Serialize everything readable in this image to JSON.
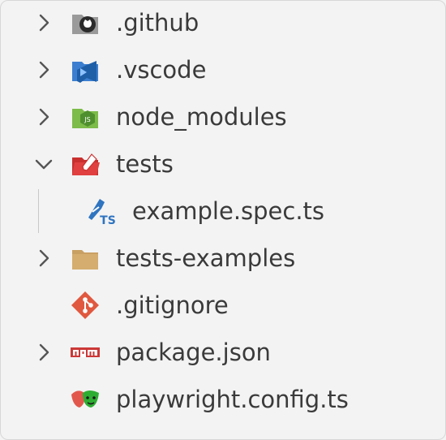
{
  "explorer": {
    "items": [
      {
        "label": ".github",
        "icon": "github-folder-icon",
        "expandable": true,
        "expanded": false
      },
      {
        "label": ".vscode",
        "icon": "vscode-folder-icon",
        "expandable": true,
        "expanded": false
      },
      {
        "label": "node_modules",
        "icon": "node-folder-icon",
        "expandable": true,
        "expanded": false
      },
      {
        "label": "tests",
        "icon": "tests-folder-icon",
        "expandable": true,
        "expanded": true
      },
      {
        "label": "example.spec.ts",
        "icon": "typescript-test-file-icon",
        "expandable": false
      },
      {
        "label": "tests-examples",
        "icon": "folder-icon",
        "expandable": true,
        "expanded": false
      },
      {
        "label": ".gitignore",
        "icon": "git-icon",
        "expandable": false
      },
      {
        "label": "package.json",
        "icon": "npm-icon",
        "expandable": true,
        "expanded": false
      },
      {
        "label": "playwright.config.ts",
        "icon": "playwright-icon",
        "expandable": false
      }
    ]
  },
  "colors": {
    "background": "#f3f3f3",
    "text": "#3a3a3a",
    "github": "#6e6e6e",
    "vscode": "#3c7fd0",
    "node": "#7dbb4a",
    "tests": "#e0403f",
    "typescript": "#2f74c0",
    "folder": "#c9a063",
    "git": "#e0583f",
    "npm": "#cb3837",
    "playwright": "#2ead33"
  }
}
